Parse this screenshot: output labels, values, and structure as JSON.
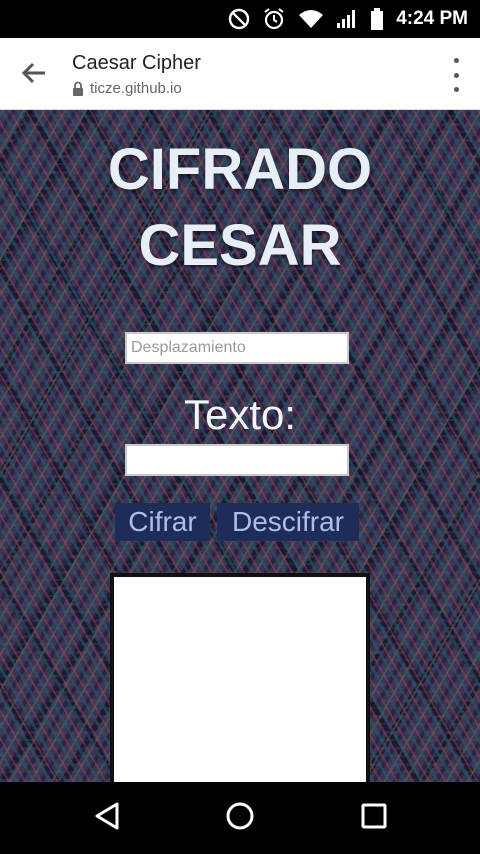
{
  "status_bar": {
    "time": "4:24 PM",
    "icons": [
      "do-not-disturb-icon",
      "alarm-icon",
      "wifi-icon",
      "signal-icon",
      "battery-icon"
    ]
  },
  "browser": {
    "title": "Caesar Cipher",
    "url": "ticze.github.io",
    "icons": [
      "back-arrow-icon",
      "lock-icon",
      "more-vert-icon"
    ]
  },
  "page": {
    "title": "CIFRADO CESAR",
    "shift_placeholder": "Desplazamiento",
    "shift_value": "",
    "text_label": "Texto:",
    "text_value": "",
    "cipher_button": "Cifrar",
    "decipher_button": "Descifrar",
    "output": ""
  },
  "nav_bar": {
    "icons": [
      "back-triangle-icon",
      "home-circle-icon",
      "recents-square-icon"
    ]
  },
  "colors": {
    "button_bg": "#1d2c58",
    "button_text": "#a8c0ea",
    "title_text": "#e8eef6"
  }
}
